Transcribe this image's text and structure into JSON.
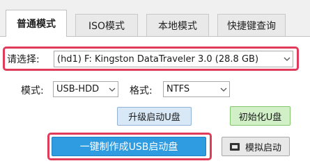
{
  "tabs": [
    {
      "label": "普通模式",
      "active": true
    },
    {
      "label": "ISO模式",
      "active": false
    },
    {
      "label": "本地模式",
      "active": false
    },
    {
      "label": "快捷键查询",
      "active": false
    }
  ],
  "device": {
    "label": "请选择:",
    "value": "(hd1) F: Kingston DataTraveler 3.0 (28.8 GB)"
  },
  "mode": {
    "label": "模式:",
    "value": "USB-HDD"
  },
  "format": {
    "label": "格式:",
    "value": "NTFS"
  },
  "buttons": {
    "upgrade": "升级启动U盘",
    "init": "初始化U盘",
    "create": "一键制作成USB启动盘",
    "simulate": "模拟启动"
  },
  "icons": {
    "chevron": "chevron-down-icon",
    "simulate": "monitor-icon"
  },
  "colors": {
    "highlight": "#e03c5a",
    "primary": "#2f9be0",
    "init": "#d2f0c8",
    "upgrade": "#d8e8f7"
  }
}
